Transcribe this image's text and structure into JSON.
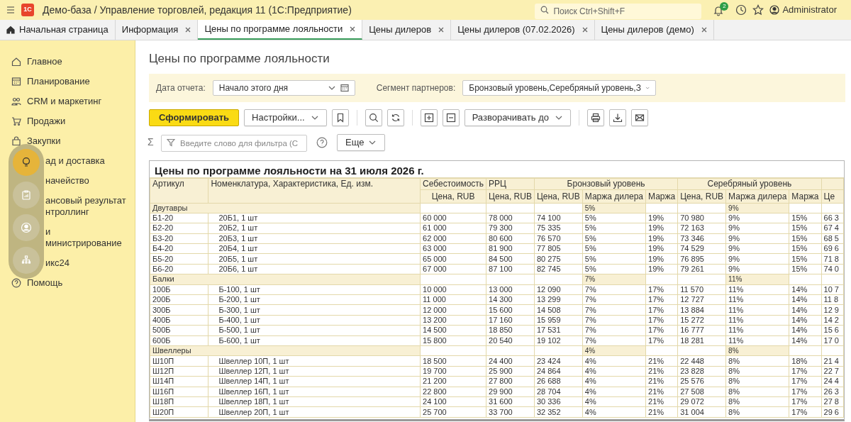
{
  "app_bar": {
    "logo": "1С",
    "title": "Демо-база / Управление торговлей, редакция 11 (1С:Предприятие)",
    "search": {
      "placeholder": "Поиск Ctrl+Shift+F"
    },
    "notifications": "2",
    "user": "Administrator"
  },
  "tabs": [
    {
      "label": "Начальная страница",
      "selected": false,
      "closable": false
    },
    {
      "label": "Информация",
      "selected": false,
      "closable": true
    },
    {
      "label": "Цены по программе лояльности",
      "selected": true,
      "closable": true
    },
    {
      "label": "Цены дилеров",
      "selected": false,
      "closable": true
    },
    {
      "label": "Цены дилеров (07.02.2026)",
      "selected": false,
      "closable": true
    },
    {
      "label": "Цены дилеров (демо)",
      "selected": false,
      "closable": true
    }
  ],
  "sidebar": {
    "items": [
      {
        "kind": "item",
        "lines": [
          "Главное"
        ]
      },
      {
        "kind": "item",
        "lines": [
          "Планирование"
        ]
      },
      {
        "kind": "item",
        "lines": [
          "CRM и маркетинг"
        ]
      },
      {
        "kind": "item",
        "lines": [
          "Продажи"
        ]
      },
      {
        "kind": "item",
        "lines": [
          "Закупки"
        ]
      },
      {
        "kind": "partial",
        "lines": [
          "ад и доставка"
        ]
      },
      {
        "kind": "partial",
        "lines": [
          "начейство"
        ]
      },
      {
        "kind": "partial",
        "lines": [
          "ансовый результат",
          "нтроллинг"
        ]
      },
      {
        "kind": "partial",
        "lines": [
          "и",
          "министрирование"
        ]
      },
      {
        "kind": "partial",
        "lines": [
          "икс24"
        ]
      },
      {
        "kind": "item",
        "lines": [
          "Помощь"
        ]
      }
    ],
    "quick_panel": [
      {
        "selected": true
      },
      {
        "selected": false
      },
      {
        "selected": false
      },
      {
        "selected": false
      }
    ]
  },
  "form": {
    "title": "Цены по программе лояльности",
    "params": [
      {
        "label": "Дата отчета:",
        "value": "Начало этого дня",
        "calendar": true
      },
      {
        "label": "Сегмент партнеров:",
        "value": "Бронзовый уровень,Серебряный уровень,З",
        "calendar": false
      }
    ],
    "toolbar": {
      "generate": "Сформировать",
      "settings": "Настройки...",
      "expand": "Разворачивать до"
    },
    "filter": {
      "sum_symbol": "Σ",
      "placeholder": "Введите слово для фильтра (С",
      "more": "Еще"
    }
  },
  "report": {
    "title": "Цены по программе лояльности на 31 июля 2026 г.",
    "columns": {
      "article": "Артикул",
      "item": "Номенклатура, Характеристика, Ед. изм.",
      "cost": "Себестоимость",
      "rrc": "РРЦ",
      "bronze": "Бронзовый уровень",
      "silver": "Серебряный уровень",
      "price": [
        "Цена, RUB",
        "Цена, RUB",
        "Цена, RUB",
        "Цена, RUB"
      ],
      "dealer_margin": [
        "Маржа дилера",
        "Маржа дилера"
      ],
      "margin": [
        "Маржа",
        "Маржа"
      ],
      "next": "Це"
    },
    "groups": [
      {
        "name": "Двутавры",
        "bronze_dealer": "5%",
        "silver_dealer": "9%",
        "rows": [
          {
            "article": "Б1-20",
            "item": "20Б1, 1 шт",
            "cost": "60 000",
            "rrc": "78 000",
            "bronze": [
              "74 100",
              "5%",
              "19%"
            ],
            "silver": [
              "70 980",
              "9%",
              "15%"
            ],
            "next": "66 3"
          },
          {
            "article": "Б2-20",
            "item": "20Б2, 1 шт",
            "cost": "61 000",
            "rrc": "79 300",
            "bronze": [
              "75 335",
              "5%",
              "19%"
            ],
            "silver": [
              "72 163",
              "9%",
              "15%"
            ],
            "next": "67 4"
          },
          {
            "article": "Б3-20",
            "item": "20Б3, 1 шт",
            "cost": "62 000",
            "rrc": "80 600",
            "bronze": [
              "76 570",
              "5%",
              "19%"
            ],
            "silver": [
              "73 346",
              "9%",
              "15%"
            ],
            "next": "68 5"
          },
          {
            "article": "Б4-20",
            "item": "20Б4, 1 шт",
            "cost": "63 000",
            "rrc": "81 900",
            "bronze": [
              "77 805",
              "5%",
              "19%"
            ],
            "silver": [
              "74 529",
              "9%",
              "15%"
            ],
            "next": "69 6"
          },
          {
            "article": "Б5-20",
            "item": "20Б5, 1 шт",
            "cost": "65 000",
            "rrc": "84 500",
            "bronze": [
              "80 275",
              "5%",
              "19%"
            ],
            "silver": [
              "76 895",
              "9%",
              "15%"
            ],
            "next": "71 8"
          },
          {
            "article": "Б6-20",
            "item": "20Б6, 1 шт",
            "cost": "67 000",
            "rrc": "87 100",
            "bronze": [
              "82 745",
              "5%",
              "19%"
            ],
            "silver": [
              "79 261",
              "9%",
              "15%"
            ],
            "next": "74 0"
          }
        ]
      },
      {
        "name": "Балки",
        "bronze_dealer": "7%",
        "silver_dealer": "11%",
        "rows": [
          {
            "article": "100Б",
            "item": "Б-100, 1 шт",
            "cost": "10 000",
            "rrc": "13 000",
            "bronze": [
              "12 090",
              "7%",
              "17%"
            ],
            "silver": [
              "11 570",
              "11%",
              "14%"
            ],
            "next": "10 7"
          },
          {
            "article": "200Б",
            "item": "Б-200, 1 шт",
            "cost": "11 000",
            "rrc": "14 300",
            "bronze": [
              "13 299",
              "7%",
              "17%"
            ],
            "silver": [
              "12 727",
              "11%",
              "14%"
            ],
            "next": "11 8"
          },
          {
            "article": "300Б",
            "item": "Б-300, 1 шт",
            "cost": "12 000",
            "rrc": "15 600",
            "bronze": [
              "14 508",
              "7%",
              "17%"
            ],
            "silver": [
              "13 884",
              "11%",
              "14%"
            ],
            "next": "12 9"
          },
          {
            "article": "400Б",
            "item": "Б-400, 1 шт",
            "cost": "13 200",
            "rrc": "17 160",
            "bronze": [
              "15 959",
              "7%",
              "17%"
            ],
            "silver": [
              "15 272",
              "11%",
              "14%"
            ],
            "next": "14 2"
          },
          {
            "article": "500Б",
            "item": "Б-500, 1 шт",
            "cost": "14 500",
            "rrc": "18 850",
            "bronze": [
              "17 531",
              "7%",
              "17%"
            ],
            "silver": [
              "16 777",
              "11%",
              "14%"
            ],
            "next": "15 6"
          },
          {
            "article": "600Б",
            "item": "Б-600, 1 шт",
            "cost": "15 800",
            "rrc": "20 540",
            "bronze": [
              "19 102",
              "7%",
              "17%"
            ],
            "silver": [
              "18 281",
              "11%",
              "14%"
            ],
            "next": "17 0"
          }
        ]
      },
      {
        "name": "Швеллеры",
        "bronze_dealer": "4%",
        "silver_dealer": "8%",
        "rows": [
          {
            "article": "Ш10П",
            "item": "Швеллер 10П, 1 шт",
            "cost": "18 500",
            "rrc": "24 400",
            "bronze": [
              "23 424",
              "4%",
              "21%"
            ],
            "silver": [
              "22 448",
              "8%",
              "18%"
            ],
            "next": "21 4"
          },
          {
            "article": "Ш12П",
            "item": "Швеллер 12П, 1 шт",
            "cost": "19 700",
            "rrc": "25 900",
            "bronze": [
              "24 864",
              "4%",
              "21%"
            ],
            "silver": [
              "23 828",
              "8%",
              "17%"
            ],
            "next": "22 7"
          },
          {
            "article": "Ш14П",
            "item": "Швеллер 14П, 1 шт",
            "cost": "21 200",
            "rrc": "27 800",
            "bronze": [
              "26 688",
              "4%",
              "21%"
            ],
            "silver": [
              "25 576",
              "8%",
              "17%"
            ],
            "next": "24 4"
          },
          {
            "article": "Ш16П",
            "item": "Швеллер 16П, 1 шт",
            "cost": "22 800",
            "rrc": "29 900",
            "bronze": [
              "28 704",
              "4%",
              "21%"
            ],
            "silver": [
              "27 508",
              "8%",
              "17%"
            ],
            "next": "26 3"
          },
          {
            "article": "Ш18П",
            "item": "Швеллер 18П, 1 шт",
            "cost": "24 100",
            "rrc": "31 600",
            "bronze": [
              "30 336",
              "4%",
              "21%"
            ],
            "silver": [
              "29 072",
              "8%",
              "17%"
            ],
            "next": "27 8"
          },
          {
            "article": "Ш20П",
            "item": "Швеллер 20П, 1 шт",
            "cost": "25 700",
            "rrc": "33 700",
            "bronze": [
              "32 352",
              "4%",
              "21%"
            ],
            "silver": [
              "31 004",
              "8%",
              "17%"
            ],
            "next": "29 6"
          }
        ]
      }
    ]
  }
}
